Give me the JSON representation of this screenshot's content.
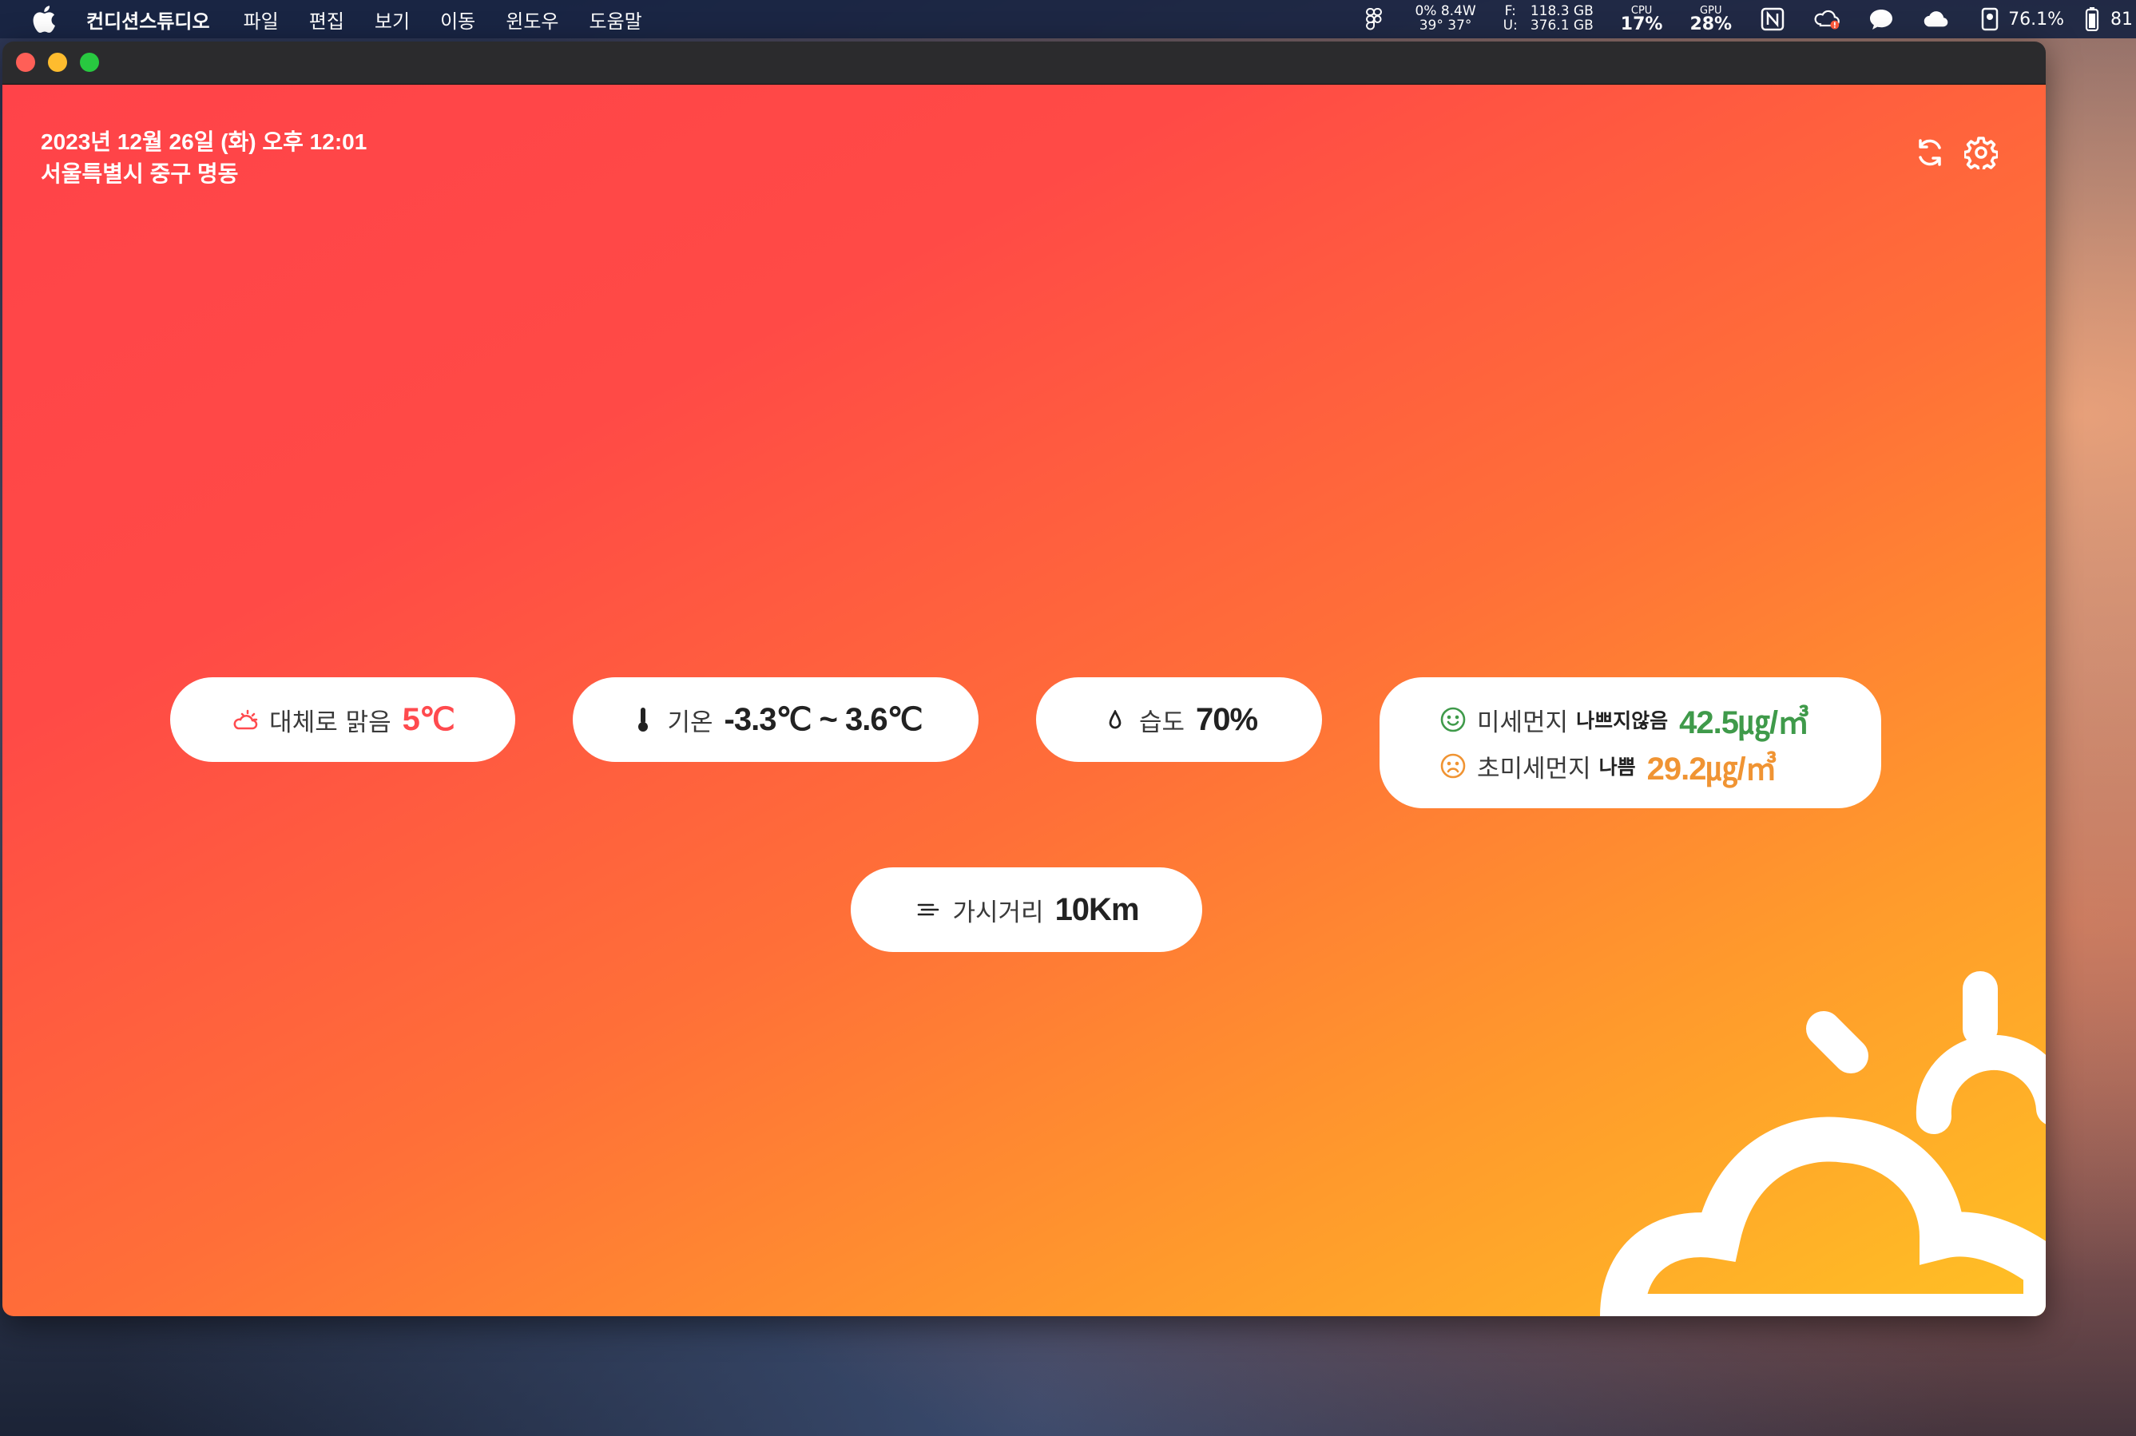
{
  "menubar": {
    "app_name": "컨디션스튜디오",
    "items": [
      "파일",
      "편집",
      "보기",
      "이동",
      "윈도우",
      "도움말"
    ],
    "status": {
      "stat1_top": "0% 8.4W",
      "stat1_bottom": "39° 37°",
      "disk_labels_top": "F:",
      "disk_labels_bottom": "U:",
      "disk_top": "118.3 GB",
      "disk_bottom": "376.1 GB",
      "cpu_label": "CPU",
      "cpu_value": "17%",
      "gpu_label": "GPU",
      "gpu_value": "28%",
      "battery_percent": "76.1%",
      "battery_value": "81"
    }
  },
  "header": {
    "datetime": "2023년 12월 26일 (화) 오후 12:01",
    "location": "서울특별시 중구 명동"
  },
  "weather": {
    "condition_label": "대체로 맑음",
    "condition_value": "5℃",
    "temp_label": "기온",
    "temp_value": "-3.3℃ ~ 3.6℃",
    "humidity_label": "습도",
    "humidity_value": "70%",
    "pm10_label": "미세먼지",
    "pm10_grade": "나쁘지않음",
    "pm10_value": "42.5㎍/㎥",
    "pm25_label": "초미세먼지",
    "pm25_grade": "나쁨",
    "pm25_value": "29.2㎍/㎥",
    "visibility_label": "가시거리",
    "visibility_value": "10Km"
  },
  "colors": {
    "gradient_start": "#ff4349",
    "gradient_end": "#ffc124",
    "good": "#3f9a4a",
    "bad": "#f09433",
    "condition_accent": "#ff4a4e"
  }
}
